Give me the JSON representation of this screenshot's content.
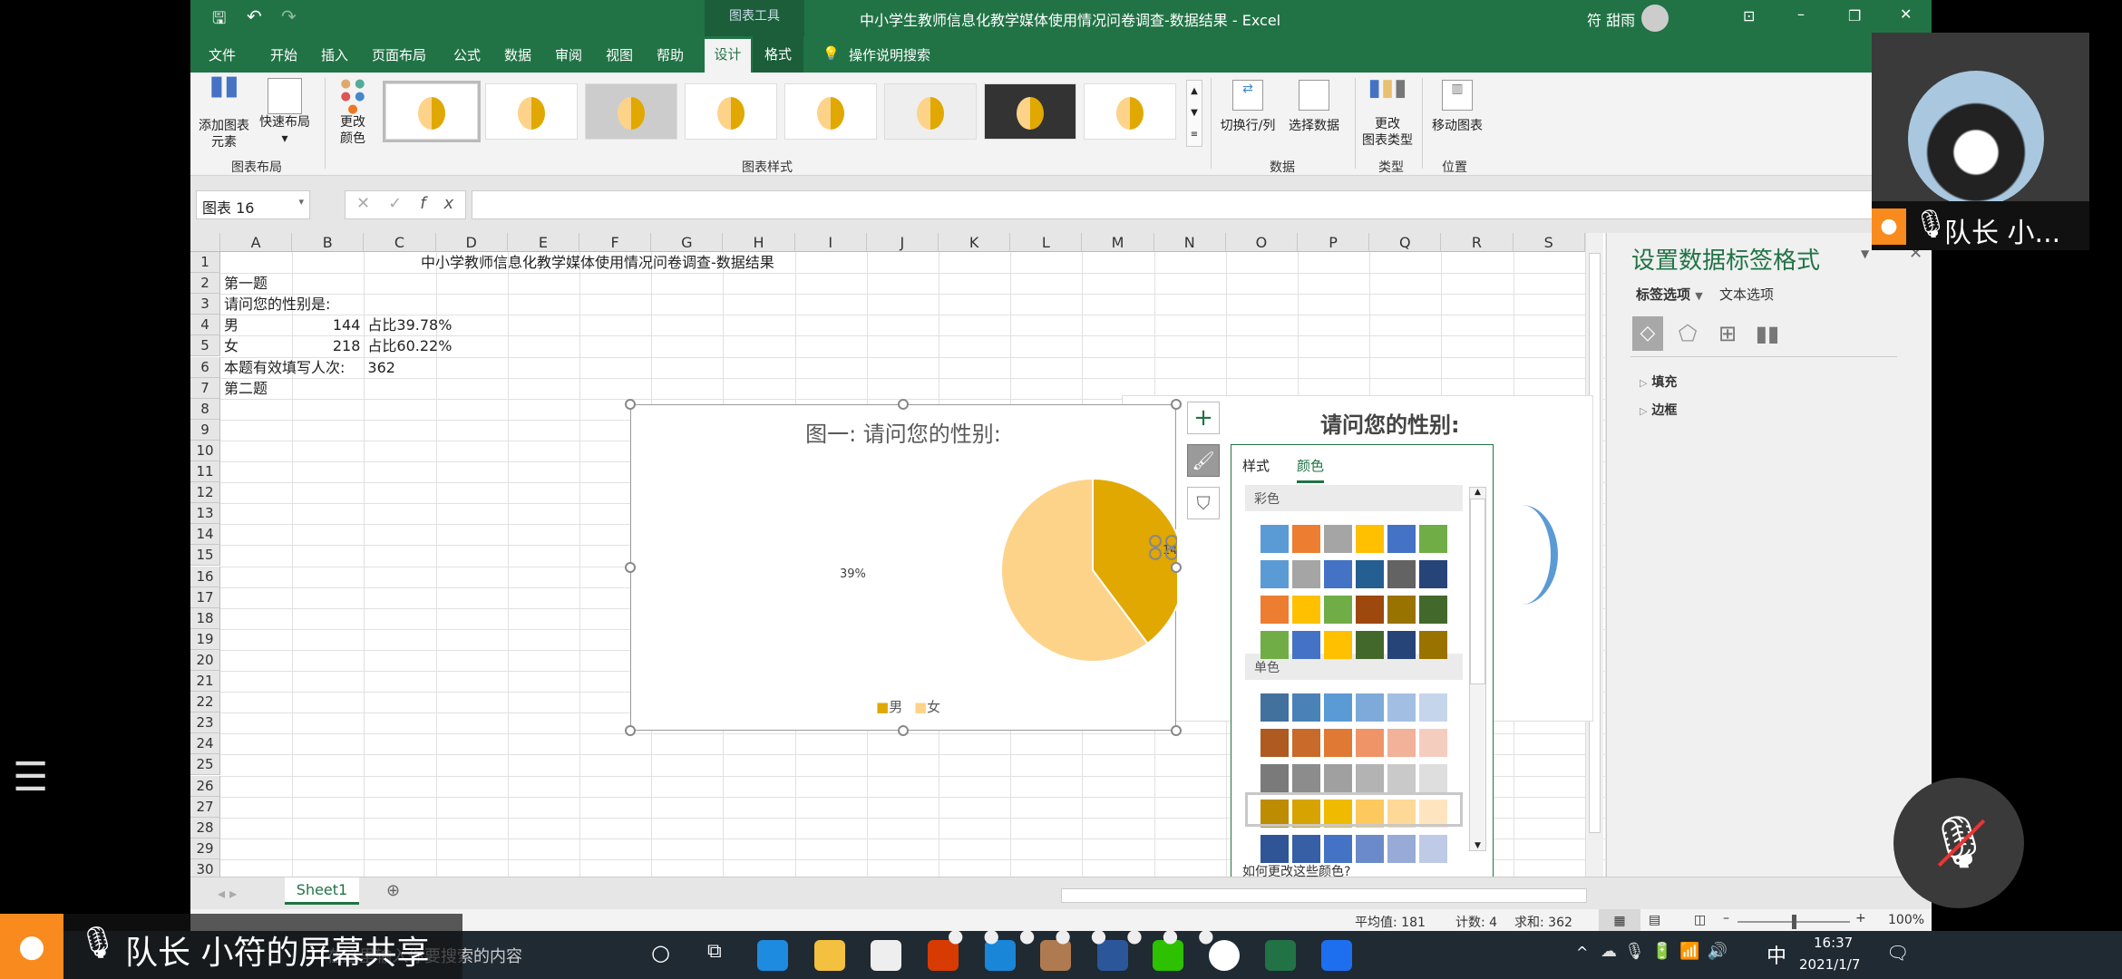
{
  "titlebar": {
    "title": "中小学生教师信息化教学媒体使用情况问卷调查-数据结果  -  Excel",
    "context_tab": "图表工具",
    "user": "符 甜雨"
  },
  "ribbon_tabs": [
    "文件",
    "开始",
    "插入",
    "页面布局",
    "公式",
    "数据",
    "审阅",
    "视图",
    "帮助",
    "设计",
    "格式"
  ],
  "active_tab": "设计",
  "tell_me": "操作说明搜索",
  "ribbon": {
    "add_element": [
      "添加图表",
      "元素"
    ],
    "quick_layout": "快速布局",
    "group_layout": "图表布局",
    "change_colors": [
      "更改",
      "颜色"
    ],
    "group_styles": "图表样式",
    "switch_row_col": "切换行/列",
    "select_data": "选择数据",
    "group_data": "数据",
    "change_type": [
      "更改",
      "图表类型"
    ],
    "group_type": "类型",
    "move_chart": "移动图表",
    "group_location": "位置"
  },
  "name_box": "图表 16",
  "formula_value": "",
  "columns": [
    "A",
    "B",
    "C",
    "D",
    "E",
    "F",
    "G",
    "H",
    "I",
    "J",
    "K",
    "L",
    "M",
    "N",
    "O",
    "P",
    "Q",
    "R",
    "S"
  ],
  "rows": 31,
  "cells": {
    "title": "中小学教师信息化教学媒体使用情况问卷调查-数据结果",
    "a2": "第一题",
    "a3": "请问您的性别是:",
    "a4": "男",
    "b4": "144",
    "c4": "占比39.78%",
    "a5": "女",
    "b5": "218",
    "c5": "占比60.22%",
    "a6": "本题有效填写人次:",
    "c6": "362",
    "a7": "第二题"
  },
  "chart_data": {
    "type": "pie",
    "title": "图一: 请问您的性别:",
    "categories": [
      "男",
      "女"
    ],
    "values": [
      144,
      218
    ],
    "colors": [
      "#E0A800",
      "#FDD38A"
    ],
    "data_labels": [
      "144",
      "39%"
    ],
    "legend": "bottom"
  },
  "chart2_title": "请问您的性别:",
  "color_panel": {
    "tabs": [
      "样式",
      "颜色"
    ],
    "active": "颜色",
    "colorful_label": "彩色",
    "mono_label": "单色",
    "help_link": "如何更改这些颜色?",
    "colorful": [
      [
        "#5B9BD5",
        "#ED7D31",
        "#A5A5A5",
        "#FFC000",
        "#4472C4",
        "#70AD47"
      ],
      [
        "#5B9BD5",
        "#A5A5A5",
        "#4472C4",
        "#255E91",
        "#636363",
        "#264478"
      ],
      [
        "#ED7D31",
        "#FFC000",
        "#70AD47",
        "#9E480E",
        "#997300",
        "#43682B"
      ],
      [
        "#70AD47",
        "#4472C4",
        "#FFC000",
        "#43682B",
        "#264478",
        "#997300"
      ]
    ],
    "mono": [
      [
        "#41719C",
        "#4A82B8",
        "#5B9BD5",
        "#7DAAD8",
        "#A2BFE3",
        "#C5D5EC"
      ],
      [
        "#AE5A21",
        "#C86A2A",
        "#E07933",
        "#EF9467",
        "#F2B199",
        "#F5CDBF"
      ],
      [
        "#7A7A7A",
        "#8C8C8C",
        "#A0A0A0",
        "#B3B3B3",
        "#C9C9C9",
        "#DEDEDE"
      ],
      [
        "#BE8C00",
        "#D7A300",
        "#F0BA00",
        "#FDC85D",
        "#FED897",
        "#FEE5C0"
      ],
      [
        "#2F5597",
        "#365FA6",
        "#4472C4",
        "#6B8AC9",
        "#98ABD6",
        "#BFCBE6"
      ]
    ],
    "selected_mono_row": 3
  },
  "pane": {
    "title": "设置数据标签格式",
    "tab_label_options": "标签选项",
    "tab_text_options": "文本选项",
    "sections": [
      "填充",
      "边框"
    ]
  },
  "sheet_tab": "Sheet1",
  "status": {
    "average": "平均值: 181",
    "count": "计数: 4",
    "sum": "求和: 362",
    "zoom": "100%"
  },
  "meeting": {
    "presenter_name": "队长 小...",
    "share_label": "队长 小符的屏幕共享"
  },
  "taskbar": {
    "search_text": "在这里输入你要搜索的内容",
    "ime": "中",
    "time": "16:37",
    "date": "2021/1/7"
  }
}
